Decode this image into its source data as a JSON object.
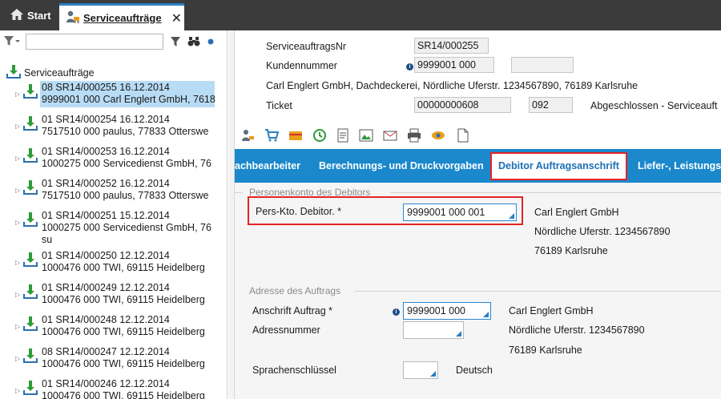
{
  "tabs": {
    "start_label": "Start",
    "active_label": "Serviceaufträge",
    "close_symbol": "✕"
  },
  "sidebar": {
    "root_label": "Serviceaufträge",
    "items": [
      {
        "line1": "08 SR14/000255 16.12.2014",
        "line2": "9999001 000 Carl Englert GmbH, 7618",
        "selected": true
      },
      {
        "line1": "01 SR14/000254 16.12.2014",
        "line2": "7517510 000 paulus, 77833 Otterswe"
      },
      {
        "line1": "01 SR14/000253 16.12.2014",
        "line2": "1000275 000 Servicedienst GmbH, 76"
      },
      {
        "line1": "01 SR14/000252 16.12.2014",
        "line2": "7517510 000 paulus, 77833 Otterswe"
      },
      {
        "line1": "01 SR14/000251 15.12.2014",
        "line2": "1000275 000 Servicedienst GmbH, 76",
        "line3": "su"
      },
      {
        "line1": "01 SR14/000250 12.12.2014",
        "line2": "1000476 000 TWI, 69115 Heidelberg"
      },
      {
        "line1": "01 SR14/000249 12.12.2014",
        "line2": "1000476 000 TWI, 69115 Heidelberg"
      },
      {
        "line1": "01 SR14/000248 12.12.2014",
        "line2": "1000476 000 TWI, 69115 Heidelberg"
      },
      {
        "line1": "08 SR14/000247 12.12.2014",
        "line2": "1000476 000 TWI, 69115 Heidelberg"
      },
      {
        "line1": "01 SR14/000246 12.12.2014",
        "line2": "1000476 000 TWI, 69115 Heidelberg"
      }
    ]
  },
  "header": {
    "auftragsnr_label": "ServiceauftragsNr",
    "auftragsnr_value": "SR14/000255",
    "kundennummer_label": "Kundennummer",
    "kundennummer_value": "9999001 000",
    "kundennummer_extra": "",
    "address_line": "Carl Englert GmbH, Dachdeckerei, Nördliche Uferstr. 1234567890, 76189 Karlsruhe",
    "ticket_label": "Ticket",
    "ticket_value": "00000000608",
    "ticket_code": "092",
    "ticket_status": "Abgeschlossen - Serviceauft"
  },
  "blue_tabs": {
    "tab1": "achbearbeiter",
    "tab2": "Berechnungs- und Druckvorgaben",
    "tab3": "Debitor Auftragsanschrift",
    "tab4": "Liefer-, Leistungs"
  },
  "debitor": {
    "section_title": "Personenkonto des Debitors",
    "field_label": "Pers-Kto. Debitor. *",
    "field_value": "9999001 000 001",
    "name": "Carl Englert GmbH",
    "street": "Nördliche Uferstr. 1234567890",
    "city": "76189 Karlsruhe"
  },
  "adresse": {
    "section_title": "Adresse des Auftrags",
    "anschrift_label": "Anschrift Auftrag *",
    "anschrift_value": "9999001 000",
    "adressnummer_label": "Adressnummer",
    "adressnummer_value": "",
    "sprache_label": "Sprachenschlüssel",
    "sprache_value": "",
    "sprache_text": "Deutsch",
    "name": "Carl Englert GmbH",
    "street": "Nördliche Uferstr. 1234567890",
    "city": "76189 Karlsruhe"
  },
  "colors": {
    "accent": "#1b88cc",
    "highlight": "#e52323",
    "selection": "#b9dcf5"
  }
}
